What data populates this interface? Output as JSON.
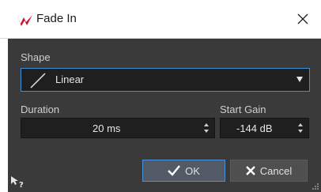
{
  "window": {
    "title": "Fade In",
    "close_glyph": "✕",
    "brand_color": "#c8102e"
  },
  "shape": {
    "label": "Shape",
    "selected": "Linear",
    "icon": "linear-fade-icon"
  },
  "duration": {
    "label": "Duration",
    "value": "20 ms"
  },
  "start_gain": {
    "label": "Start Gain",
    "value": "-144 dB"
  },
  "buttons": {
    "ok_label": "OK",
    "cancel_label": "Cancel"
  },
  "colors": {
    "dialog_bg": "#3a3a3a",
    "field_bg": "#1f1f1f",
    "focus_border": "#3d8fd6"
  }
}
